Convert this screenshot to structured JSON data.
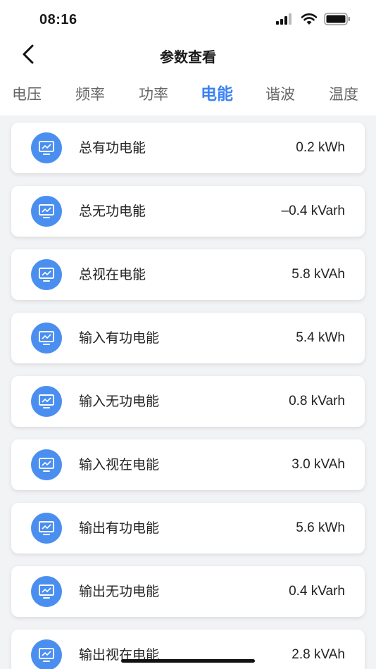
{
  "status_bar": {
    "time": "08:16",
    "icons": [
      "signal-icon",
      "wifi-icon",
      "battery-icon"
    ]
  },
  "nav": {
    "title": "参数查看",
    "back_icon": "chevron-left-icon"
  },
  "tabs": [
    {
      "label": "电压",
      "active": false
    },
    {
      "label": "频率",
      "active": false
    },
    {
      "label": "功率",
      "active": false
    },
    {
      "label": "电能",
      "active": true
    },
    {
      "label": "谐波",
      "active": false
    },
    {
      "label": "温度",
      "active": false
    }
  ],
  "items": [
    {
      "label": "总有功电能",
      "value": "0.2 kWh"
    },
    {
      "label": "总无功电能",
      "value": "–0.4 kVarh"
    },
    {
      "label": "总视在电能",
      "value": "5.8 kVAh"
    },
    {
      "label": "输入有功电能",
      "value": "5.4 kWh"
    },
    {
      "label": "输入无功电能",
      "value": "0.8 kVarh"
    },
    {
      "label": "输入视在电能",
      "value": "3.0 kVAh"
    },
    {
      "label": "输出有功电能",
      "value": "5.6 kWh"
    },
    {
      "label": "输出无功电能",
      "value": "0.4 kVarh"
    },
    {
      "label": "输出视在电能",
      "value": "2.8 kVAh"
    }
  ],
  "colors": {
    "accent": "#3b82f6",
    "icon_bg": "#4a8ff0",
    "background": "#f2f3f5"
  }
}
